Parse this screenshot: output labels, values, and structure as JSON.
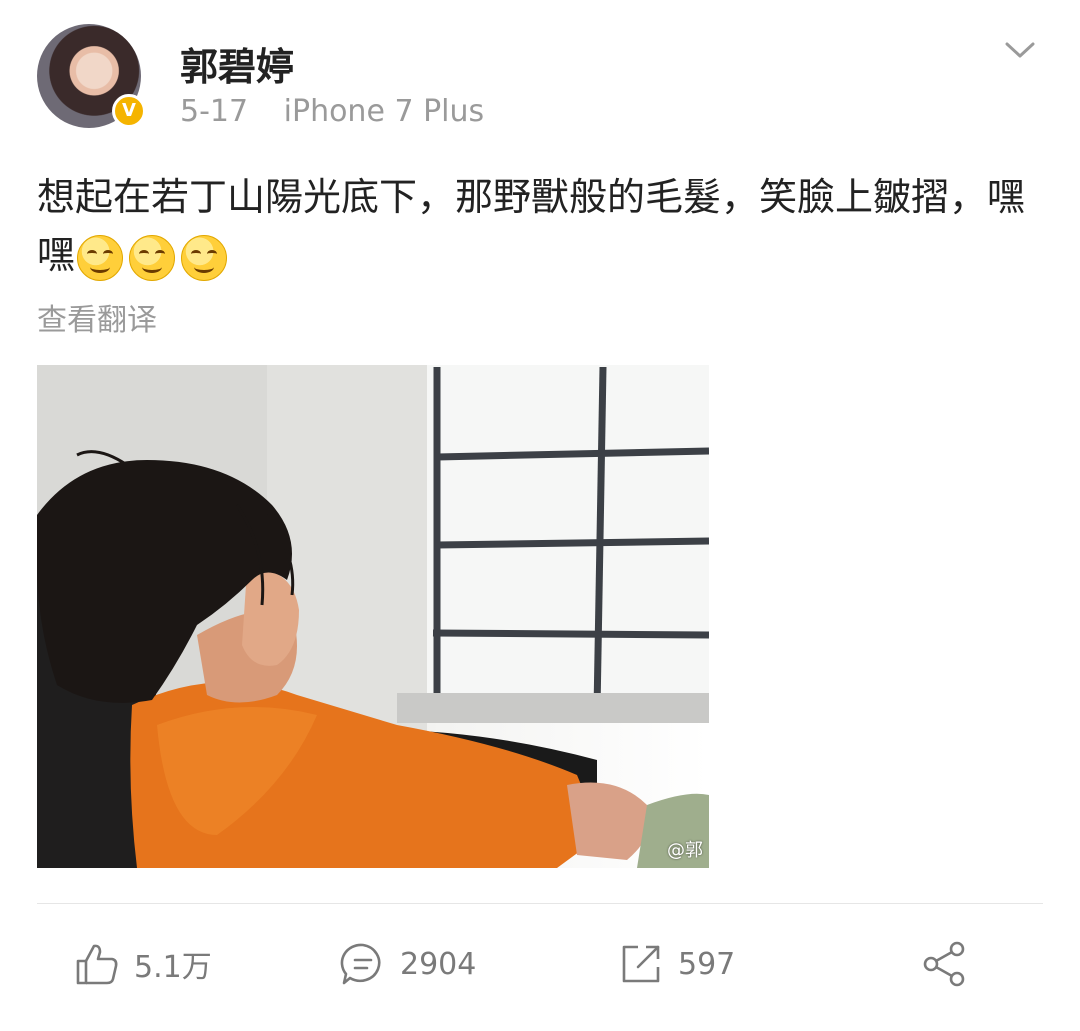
{
  "post": {
    "author": "郭碧婷",
    "date": "5-17",
    "device": "iPhone 7 Plus",
    "text": "想起在若丁山陽光底下，那野獸般的毛髮，笑臉上皺摺，嘿嘿",
    "emoji_count": 3,
    "translate_label": "查看翻译",
    "image_watermark": "@郭"
  },
  "actions": {
    "like_count": "5.1万",
    "comment_count": "2904",
    "repost_count": "597"
  },
  "icons": {
    "verified": "verified-badge-icon",
    "menu": "chevron-down-icon",
    "like": "thumbs-up-icon",
    "comment": "comment-bubble-icon",
    "repost": "repost-icon",
    "share": "share-icon"
  },
  "colors": {
    "verified_badge": "#f5b400",
    "secondary_text": "#9a9a9a",
    "icon_gray": "#7a7a7a"
  }
}
